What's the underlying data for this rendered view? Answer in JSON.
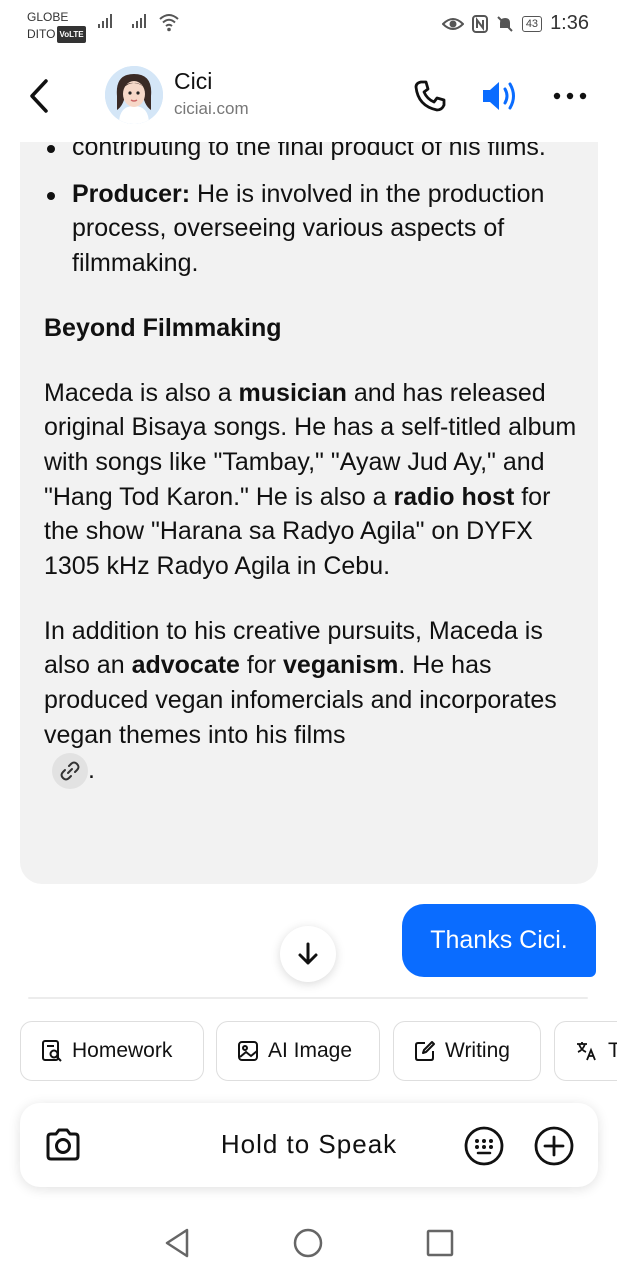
{
  "status_bar": {
    "carrier_1": "GLOBE",
    "carrier_2": "DITO",
    "volte": "VoLTE",
    "battery": "43",
    "time": "1:36"
  },
  "header": {
    "name": "Cici",
    "domain": "ciciai.com"
  },
  "message": {
    "line_top": "contributing to the final product of his films.",
    "bullet_producer_label": "Producer:",
    "bullet_producer_text": " He is involved in the production process, overseeing various aspects of filmmaking.",
    "section_heading": "Beyond Filmmaking",
    "p1_a": "Maceda is also a ",
    "p1_musician": "musician",
    "p1_b": " and has released original Bisaya songs. He has a self-titled album with songs like \"Tambay,\" \"Ayaw Jud Ay,\" and \"Hang Tod Karon.\" He is also a ",
    "p1_radio": "radio host",
    "p1_c": " for the show \"Harana sa Radyo Agila\" on DYFX 1305 kHz Radyo Agila in Cebu.",
    "p2_a": "In addition to his creative pursuits, Maceda is also an ",
    "p2_advocate": "advocate",
    "p2_b": " for ",
    "p2_veganism": "veganism",
    "p2_c": ". He has produced vegan infomercials and incorporates vegan themes into his films",
    "p2_end": "."
  },
  "user_message": "Thanks Cici.",
  "chips": [
    {
      "label": "Homework",
      "icon": "homework-icon"
    },
    {
      "label": "AI Image",
      "icon": "image-icon"
    },
    {
      "label": "Writing",
      "icon": "writing-icon"
    },
    {
      "label": "T",
      "icon": "translate-icon"
    }
  ],
  "input": {
    "hold_to_speak": "Hold to Speak"
  },
  "colors": {
    "accent": "#0a6cff",
    "card_bg": "#f2f2f2"
  }
}
